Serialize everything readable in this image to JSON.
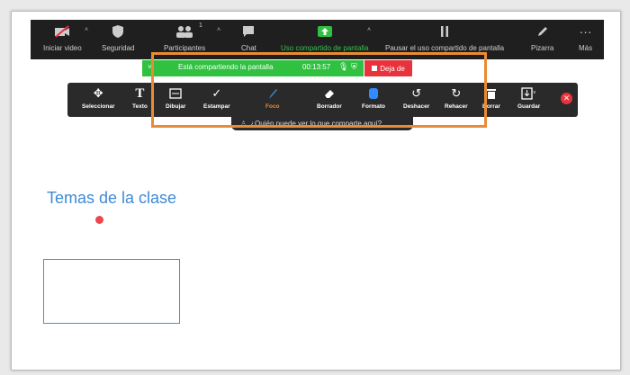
{
  "topbar": {
    "items": [
      {
        "label": "Iniciar video",
        "icon": "video-off-icon"
      },
      {
        "label": "Seguridad",
        "icon": "shield-icon"
      },
      {
        "label": "Participantes",
        "icon": "participants-icon",
        "count": "1"
      },
      {
        "label": "Chat",
        "icon": "chat-icon"
      },
      {
        "label": "Uso compartido de pantalla",
        "icon": "share-screen-icon"
      },
      {
        "label": "Pausar el uso compartido de pantalla",
        "icon": "pause-icon"
      },
      {
        "label": "Pizarra",
        "icon": "pen-icon"
      },
      {
        "label": "Más",
        "icon": "more-icon"
      }
    ]
  },
  "sharebar": {
    "status": "Está compartiendo la pantalla",
    "time": "00:13:57",
    "stop_label": "Deja de"
  },
  "annotation": {
    "tools": [
      {
        "label": "Seleccionar",
        "icon": "select-icon"
      },
      {
        "label": "Texto",
        "icon": "text-icon"
      },
      {
        "label": "Dibujar",
        "icon": "draw-icon"
      },
      {
        "label": "Estampar",
        "icon": "stamp-icon"
      },
      {
        "label": "Foco",
        "icon": "spotlight-icon"
      },
      {
        "label": "Borrador",
        "icon": "eraser-icon"
      },
      {
        "label": "Formato",
        "icon": "format-icon"
      },
      {
        "label": "Deshacer",
        "icon": "undo-icon"
      },
      {
        "label": "Rehacer",
        "icon": "redo-icon"
      },
      {
        "label": "Borrar",
        "icon": "trash-icon"
      },
      {
        "label": "Guardar",
        "icon": "save-icon"
      }
    ],
    "who_can_see": "¿Quién puede ver lo que comparte aquí?"
  },
  "content": {
    "title": "Temas de la clase"
  },
  "colors": {
    "share_green": "#2fc13f",
    "stop_red": "#e8333c",
    "highlight": "#e98b36",
    "title_blue": "#3d8ad6"
  }
}
